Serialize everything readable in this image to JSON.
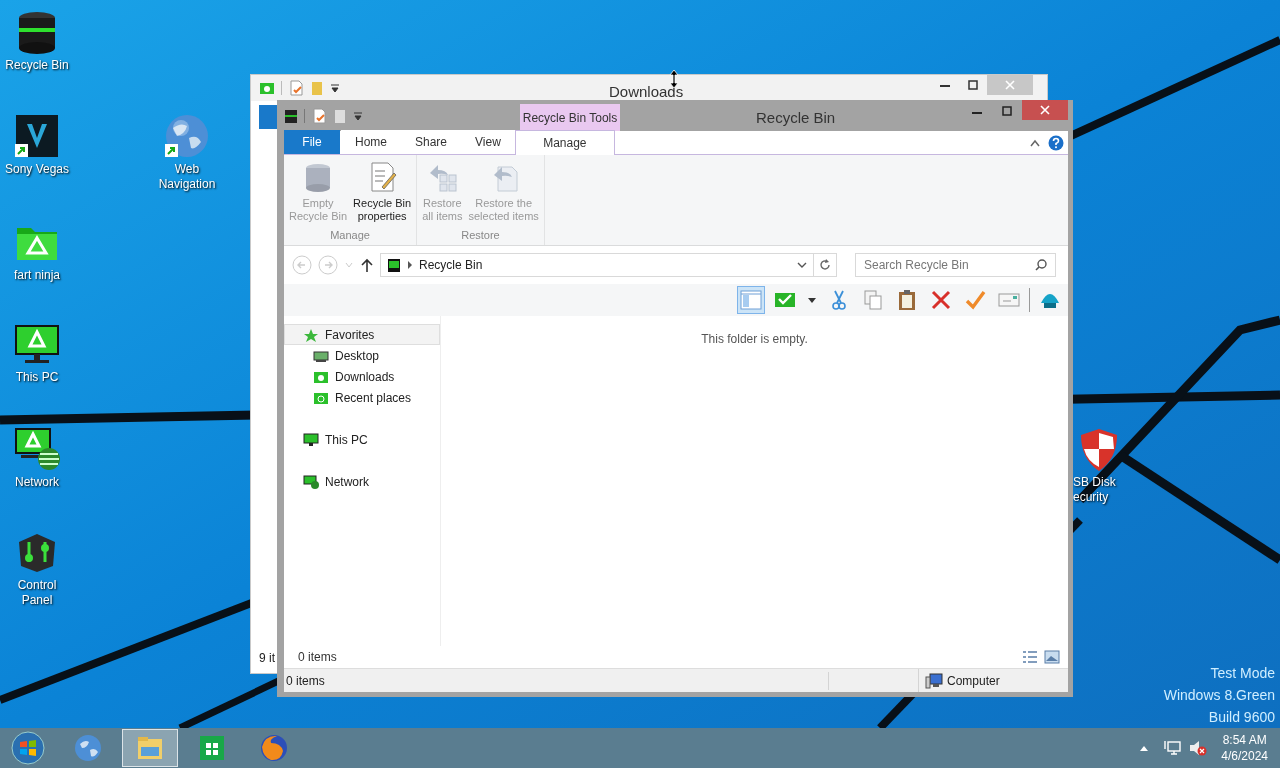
{
  "desktop": {
    "icons": [
      {
        "kind": "recycle",
        "label": "Recycle Bin",
        "shortcut": false
      },
      {
        "kind": "video",
        "label": "Sony Vegas",
        "shortcut": true
      },
      {
        "kind": "globe",
        "label": "Web\nNavigation",
        "shortcut": true
      },
      {
        "kind": "folder",
        "label": "fart ninja",
        "shortcut": false
      },
      {
        "kind": "monitor",
        "label": "This PC",
        "shortcut": false
      },
      {
        "kind": "network",
        "label": "Network",
        "shortcut": false
      },
      {
        "kind": "control",
        "label": "Control\nPanel",
        "shortcut": false
      },
      {
        "kind": "shield",
        "label": "SB Disk\necurity",
        "shortcut": false
      }
    ],
    "watermark": [
      "Test Mode",
      "Windows 8.Green",
      "Build 9600"
    ]
  },
  "back_window": {
    "title": "Downloads",
    "status": "9 it"
  },
  "window": {
    "title": "Recycle Bin",
    "context_tab": "Recycle Bin Tools",
    "tabs": [
      {
        "label": "File",
        "kind": "file",
        "selected": false
      },
      {
        "label": "Home",
        "kind": "tab",
        "selected": false
      },
      {
        "label": "Share",
        "kind": "tab",
        "selected": false
      },
      {
        "label": "View",
        "kind": "tab",
        "selected": false
      },
      {
        "label": "Manage",
        "kind": "context",
        "selected": true
      }
    ],
    "ribbon_groups": [
      {
        "label": "Manage",
        "buttons": [
          {
            "kind": "empty",
            "label": "Empty\nRecycle Bin",
            "disabled": true
          },
          {
            "kind": "properties",
            "label": "Recycle Bin\nproperties",
            "disabled": false
          }
        ]
      },
      {
        "label": "Restore",
        "buttons": [
          {
            "kind": "restore-all",
            "label": "Restore\nall items",
            "disabled": true
          },
          {
            "kind": "restore-selected",
            "label": "Restore the\nselected items",
            "disabled": true
          }
        ]
      }
    ],
    "address": {
      "path": "Recycle Bin"
    },
    "search": {
      "placeholder": "Search Recycle Bin"
    },
    "details_pane": {
      "on": true
    },
    "nav": [
      {
        "label": "Favorites",
        "kind": "favorites",
        "selected": true,
        "children": [
          {
            "label": "Desktop",
            "kind": "desktop",
            "selected": false
          },
          {
            "label": "Downloads",
            "kind": "downloads",
            "selected": false
          },
          {
            "label": "Recent places",
            "kind": "recent",
            "selected": false
          }
        ]
      },
      {
        "label": "This PC",
        "kind": "pc",
        "selected": false
      },
      {
        "label": "Network",
        "kind": "net",
        "selected": false
      }
    ],
    "empty_message": "This folder is empty.",
    "item_count": "0 items",
    "status": {
      "count": "0 items",
      "zone": "Computer"
    }
  },
  "taskbar": {
    "apps": [
      {
        "kind": "globe",
        "selected": false
      },
      {
        "kind": "explorer",
        "selected": true
      },
      {
        "kind": "store",
        "selected": false
      },
      {
        "kind": "firefox",
        "selected": false
      }
    ],
    "clock": {
      "time": "8:54 AM",
      "date": "4/6/2024"
    }
  }
}
